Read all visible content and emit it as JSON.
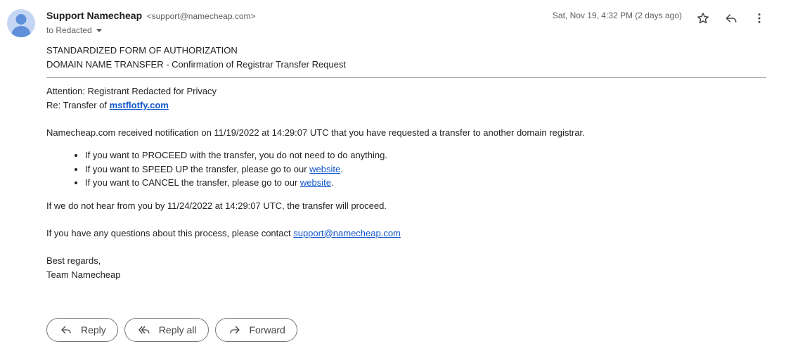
{
  "sender": {
    "name": "Support Namecheap",
    "email": "<support@namecheap.com>",
    "to": "to Redacted",
    "date": "Sat, Nov 19, 4:32 PM (2 days ago)"
  },
  "icons": {
    "avatar": "person-icon",
    "star": "star-icon",
    "reply": "reply-icon",
    "more": "more-vert-icon",
    "reply_all": "reply-all-icon",
    "forward": "forward-icon"
  },
  "body": {
    "heading1": "STANDARDIZED FORM OF AUTHORIZATION",
    "heading2": "DOMAIN NAME TRANSFER - Confirmation of Registrar Transfer Request",
    "attention": "Attention: Registrant Redacted for Privacy",
    "re_prefix": "Re: Transfer of ",
    "domain": "mstflotfy.com",
    "notification": "Namecheap.com received notification on 11/19/2022 at 14:29:07 UTC that you have requested a transfer to another domain registrar.",
    "bullets": {
      "proceed": "If you want to PROCEED with the transfer, you do not need to do anything.",
      "speed_prefix": "If you want to SPEED UP the transfer, please go to our ",
      "cancel_prefix": "If you want to CANCEL the transfer, please go to our ",
      "link_text": "website",
      "suffix": "."
    },
    "deadline": "If we do not hear from you by 11/24/2022 at 14:29:07 UTC, the transfer will proceed.",
    "questions_prefix": "If you have any questions about this process, please contact ",
    "support_email": "support@namecheap.com",
    "closing": "Best regards,",
    "team": "Team Namecheap"
  },
  "actions": {
    "reply": "Reply",
    "reply_all": "Reply all",
    "forward": "Forward"
  },
  "colors": {
    "link": "#1155cc",
    "avatar_bg": "#c4d6f3",
    "avatar_fg": "#5f8fd8"
  }
}
